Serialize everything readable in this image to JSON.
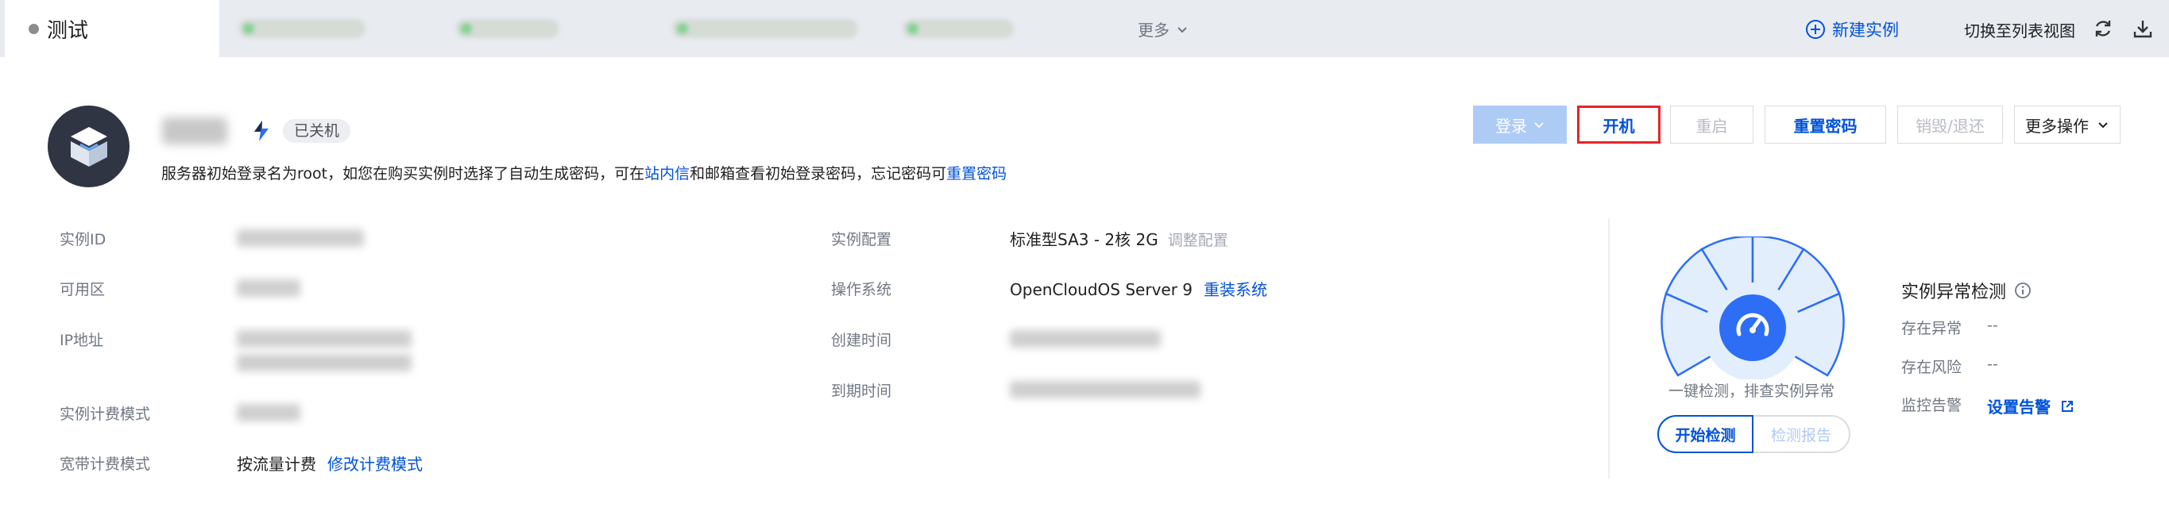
{
  "tabs": {
    "active_label": "测试",
    "more_label": "更多"
  },
  "top_actions": {
    "new_instance": "新建实例",
    "switch_view": "切换至列表视图"
  },
  "instance": {
    "status": "已关机",
    "hint_prefix": "服务器初始登录名为root，如您在购买实例时选择了自动生成密码，可在",
    "hint_link1": "站内信",
    "hint_middle": "和邮箱查看初始登录密码，忘记密码可",
    "hint_link2": "重置密码"
  },
  "actions": {
    "login": "登录",
    "start": "开机",
    "restart": "重启",
    "reset_password": "重置密码",
    "destroy": "销毁/退还",
    "more": "更多操作"
  },
  "details_left": {
    "instance_id_label": "实例ID",
    "zone_label": "可用区",
    "ip_label": "IP地址",
    "billing_label": "实例计费模式",
    "bandwidth_label": "宽带计费模式",
    "bandwidth_value": "按流量计费",
    "bandwidth_link": "修改计费模式"
  },
  "details_mid": {
    "config_label": "实例配置",
    "config_value": "标准型SA3 - 2核 2G",
    "config_link": "调整配置",
    "os_label": "操作系统",
    "os_value": "OpenCloudOS Server 9",
    "os_link": "重装系统",
    "created_label": "创建时间",
    "expire_label": "到期时间"
  },
  "detection": {
    "caption": "一键检测，排查实例异常",
    "start_button": "开始检测",
    "report_button": "检测报告",
    "title": "实例异常检测",
    "rows": [
      {
        "label": "存在异常",
        "value": "--"
      },
      {
        "label": "存在风险",
        "value": "--"
      },
      {
        "label": "监控告警",
        "value": ""
      }
    ],
    "alarm_link": "设置告警"
  },
  "colors": {
    "accent": "#0052d9",
    "highlight_border": "#e5242b",
    "tab_bar": "#e8ebf0"
  }
}
